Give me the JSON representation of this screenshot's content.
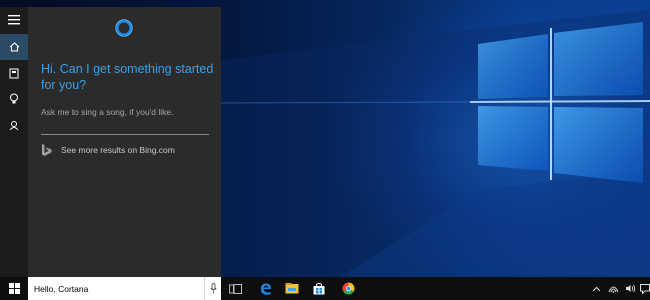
{
  "cortana": {
    "greeting": "Hi. Can I get something started for you?",
    "hint": "Ask me to sing a song, if you'd like.",
    "bing_link": "See more results on Bing.com",
    "rail": [
      "menu-icon",
      "home-icon",
      "notebook-icon",
      "lightbulb-icon",
      "feedback-icon"
    ]
  },
  "taskbar": {
    "search_value": "Hello, Cortana",
    "pinned": [
      "task-view-icon",
      "edge-icon",
      "file-explorer-icon",
      "store-icon",
      "chrome-icon"
    ],
    "tray": [
      "chevron-up-icon",
      "network-icon",
      "volume-icon",
      "notifications-icon"
    ]
  },
  "colors": {
    "accent": "#3aa0ec",
    "panel": "#2b2b2b",
    "rail": "#1c1c1c",
    "taskbar": "#0e0e0e"
  }
}
